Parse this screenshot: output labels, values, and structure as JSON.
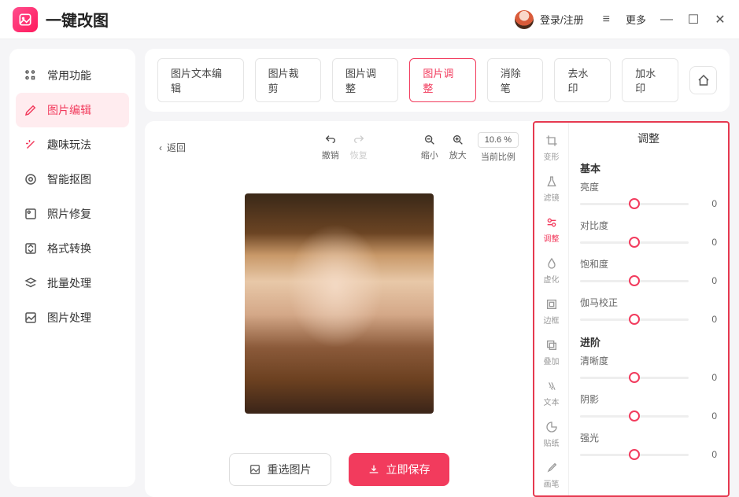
{
  "app": {
    "title": "一键改图",
    "login": "登录/注册",
    "more": "更多"
  },
  "sidebar": {
    "items": [
      {
        "label": "常用功能"
      },
      {
        "label": "图片编辑"
      },
      {
        "label": "趣味玩法"
      },
      {
        "label": "智能抠图"
      },
      {
        "label": "照片修复"
      },
      {
        "label": "格式转换"
      },
      {
        "label": "批量处理"
      },
      {
        "label": "图片处理"
      }
    ]
  },
  "tabs": {
    "items": [
      {
        "label": "图片文本编辑"
      },
      {
        "label": "图片裁剪"
      },
      {
        "label": "图片调整"
      },
      {
        "label": "图片调整"
      },
      {
        "label": "消除笔"
      },
      {
        "label": "去水印"
      },
      {
        "label": "加水印"
      }
    ]
  },
  "canvas": {
    "back": "返回",
    "undo": "撤销",
    "redo": "恢复",
    "zoomOut": "缩小",
    "zoomIn": "放大",
    "ratio": "10.6 %",
    "ratioLabel": "当前比例",
    "reselect": "重选图片",
    "save": "立即保存"
  },
  "strip": {
    "items": [
      {
        "label": "变形"
      },
      {
        "label": "滤镜"
      },
      {
        "label": "调整"
      },
      {
        "label": "虚化"
      },
      {
        "label": "边框"
      },
      {
        "label": "叠加"
      },
      {
        "label": "文本"
      },
      {
        "label": "贴纸"
      },
      {
        "label": "画笔"
      }
    ]
  },
  "adjust": {
    "title": "调整",
    "groups": [
      {
        "name": "基本",
        "sliders": [
          {
            "label": "亮度",
            "value": "0"
          },
          {
            "label": "对比度",
            "value": "0"
          },
          {
            "label": "饱和度",
            "value": "0"
          },
          {
            "label": "伽马校正",
            "value": "0"
          }
        ]
      },
      {
        "name": "进阶",
        "sliders": [
          {
            "label": "清晰度",
            "value": "0"
          },
          {
            "label": "阴影",
            "value": "0"
          },
          {
            "label": "强光",
            "value": "0"
          }
        ]
      }
    ]
  }
}
